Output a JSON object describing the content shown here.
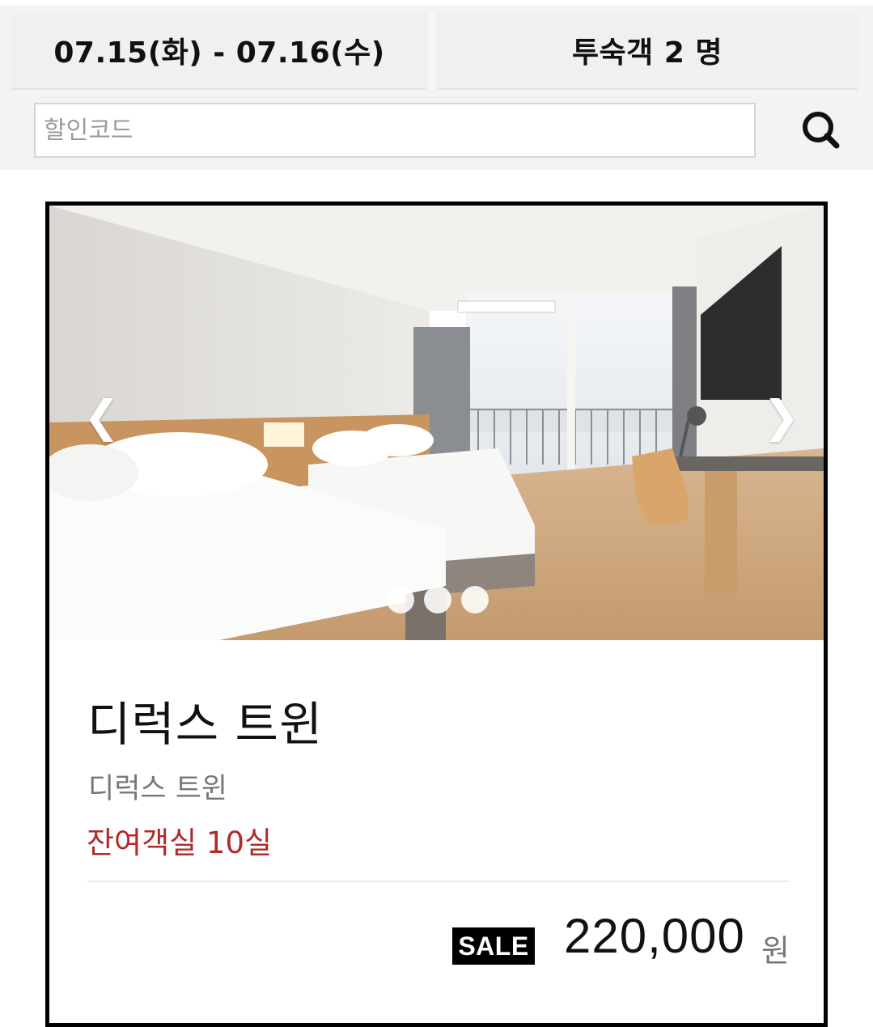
{
  "booking": {
    "dates": "07.15(화) - 07.16(수)",
    "guests": "투숙객 2 명"
  },
  "coupon": {
    "placeholder": "할인코드",
    "search_icon": "search-icon"
  },
  "room": {
    "slider": {
      "prev_icon": "chevron-left-icon",
      "next_icon": "chevron-right-icon",
      "prev_glyph": "❮",
      "next_glyph": "❯",
      "slide_count": 3
    },
    "title": "디럭스 트윈",
    "subtitle": "디럭스 트윈",
    "remaining": "잔여객실 10실",
    "sale_badge": "SALE",
    "price": "220,000",
    "currency": "원"
  },
  "colors": {
    "remaining_text": "#b02a2a",
    "card_border": "#000000",
    "top_background": "#f3f3f3"
  }
}
